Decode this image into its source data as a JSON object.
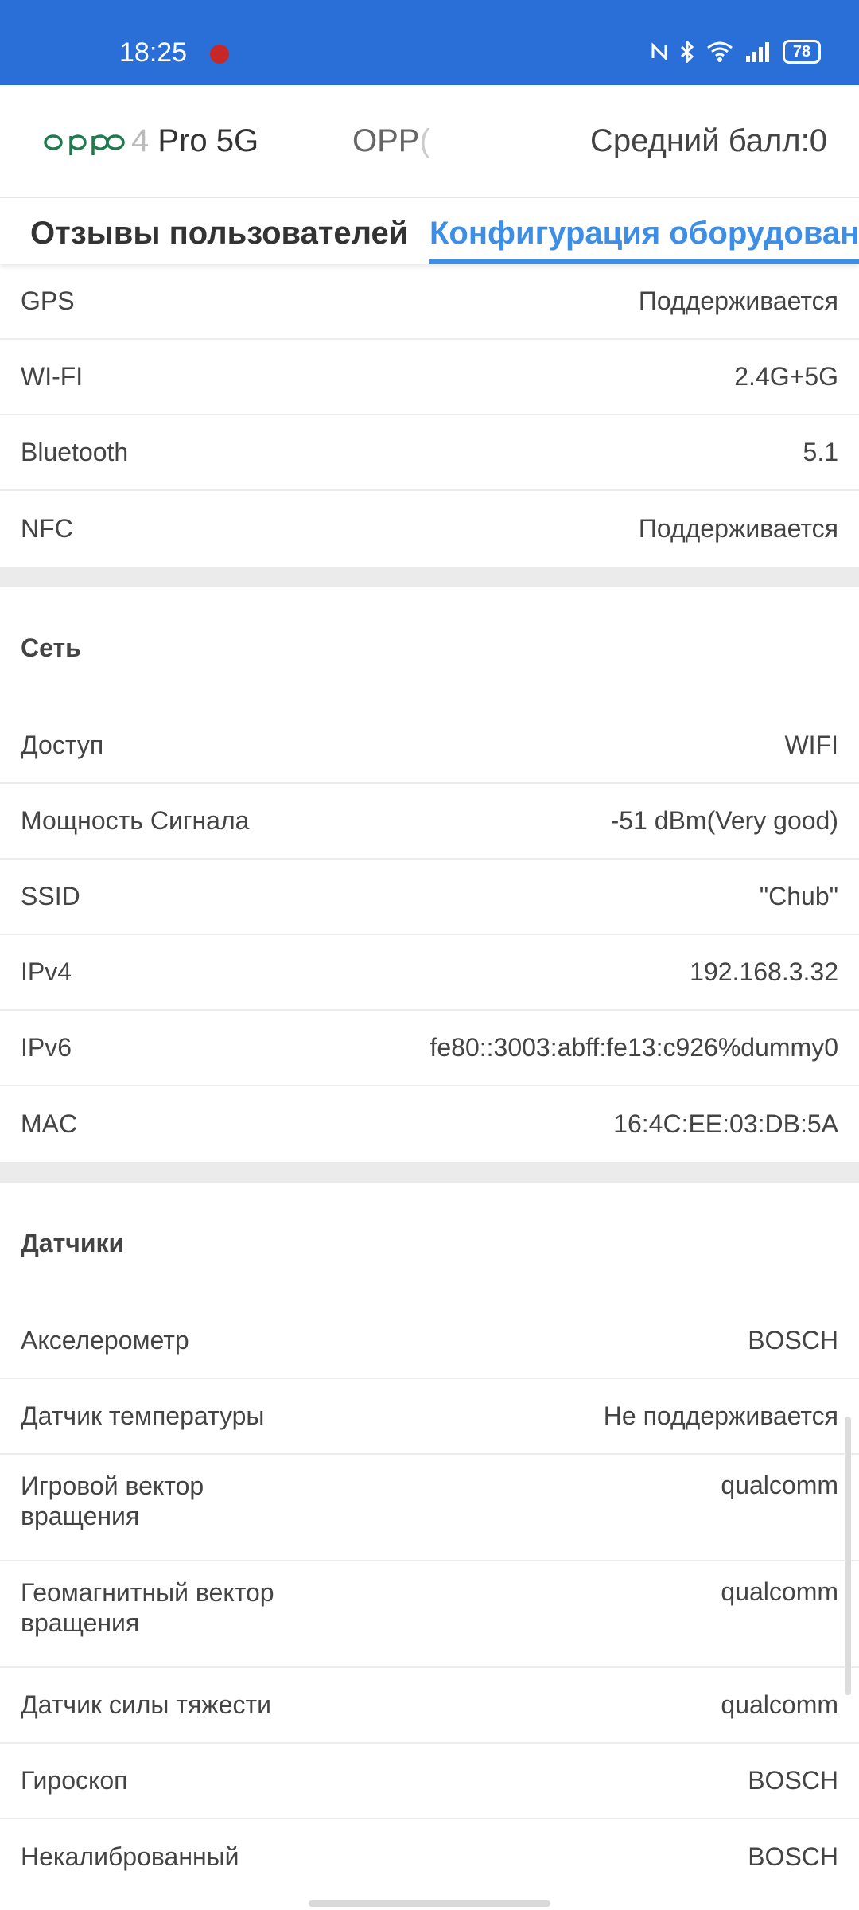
{
  "status_bar": {
    "time": "18:25",
    "battery": "78"
  },
  "header": {
    "logo_text": "oppo",
    "model_left": {
      "hint": "4",
      "text": "Pro 5G"
    },
    "model_right": {
      "text": "OPP",
      "hint": "("
    },
    "score": "Средний балл:0"
  },
  "tabs": {
    "reviews": "Отзывы пользователей",
    "hardware": "Конфигурация оборудовани"
  },
  "connectivity": [
    {
      "key": "GPS",
      "value": "Поддерживается"
    },
    {
      "key": "WI-FI",
      "value": "2.4G+5G"
    },
    {
      "key": "Bluetooth",
      "value": "5.1"
    },
    {
      "key": "NFC",
      "value": "Поддерживается"
    }
  ],
  "network": {
    "title": "Сеть",
    "rows": [
      {
        "key": "Доступ",
        "value": "WIFI"
      },
      {
        "key": "Мощность Сигнала",
        "value": "-51 dBm(Very good)"
      },
      {
        "key": "SSID",
        "value": "\"Chub\""
      },
      {
        "key": "IPv4",
        "value": "192.168.3.32"
      },
      {
        "key": "IPv6",
        "value": "fe80::3003:abff:fe13:c926%dummy0"
      },
      {
        "key": "MAC",
        "value": "16:4C:EE:03:DB:5A"
      }
    ]
  },
  "sensors": {
    "title": "Датчики",
    "rows": [
      {
        "key": "Акселерометр",
        "value": "BOSCH"
      },
      {
        "key": "Датчик температуры",
        "value": "Не поддерживается"
      },
      {
        "key": "Игровой вектор вращения",
        "value": "qualcomm"
      },
      {
        "key": "Геомагнитный вектор вращения",
        "value": "qualcomm"
      },
      {
        "key": "Датчик силы тяжести",
        "value": "qualcomm"
      },
      {
        "key": "Гироскоп",
        "value": "BOSCH"
      },
      {
        "key": "Некалиброванный",
        "value": "BOSCH"
      }
    ]
  }
}
